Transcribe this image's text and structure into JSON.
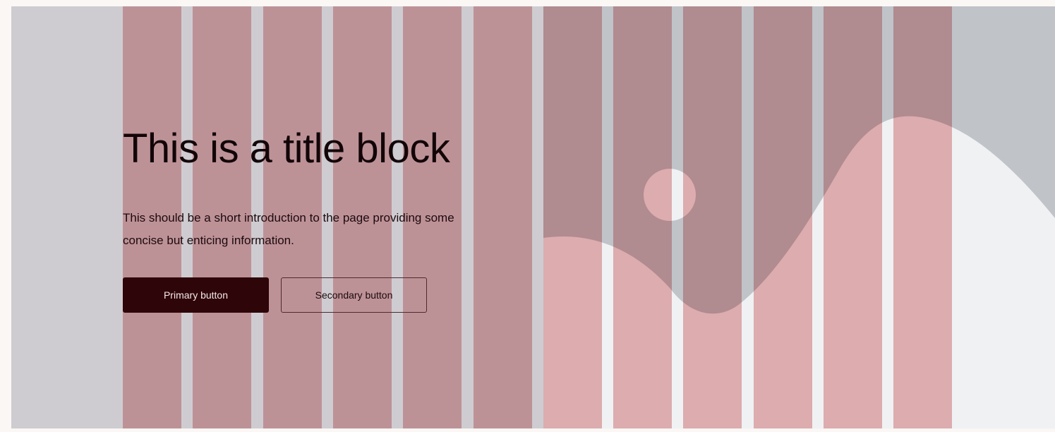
{
  "hero": {
    "title": "This is a title block",
    "intro": "This should be a short introduction to the page providing some concise but enticing information.",
    "primary_button_label": "Primary button",
    "secondary_button_label": "Secondary button"
  },
  "layout_grid": {
    "columns": 12,
    "column_color": "#d9797e"
  },
  "colors": {
    "canvas_bg": "#ceccd1",
    "placeholder_sky": "#c0c3c8",
    "placeholder_ground": "#f0f1f3",
    "primary_button": "#2e0508",
    "text": "#120508"
  },
  "image_placeholder": {
    "icon": "image-placeholder-icon"
  }
}
